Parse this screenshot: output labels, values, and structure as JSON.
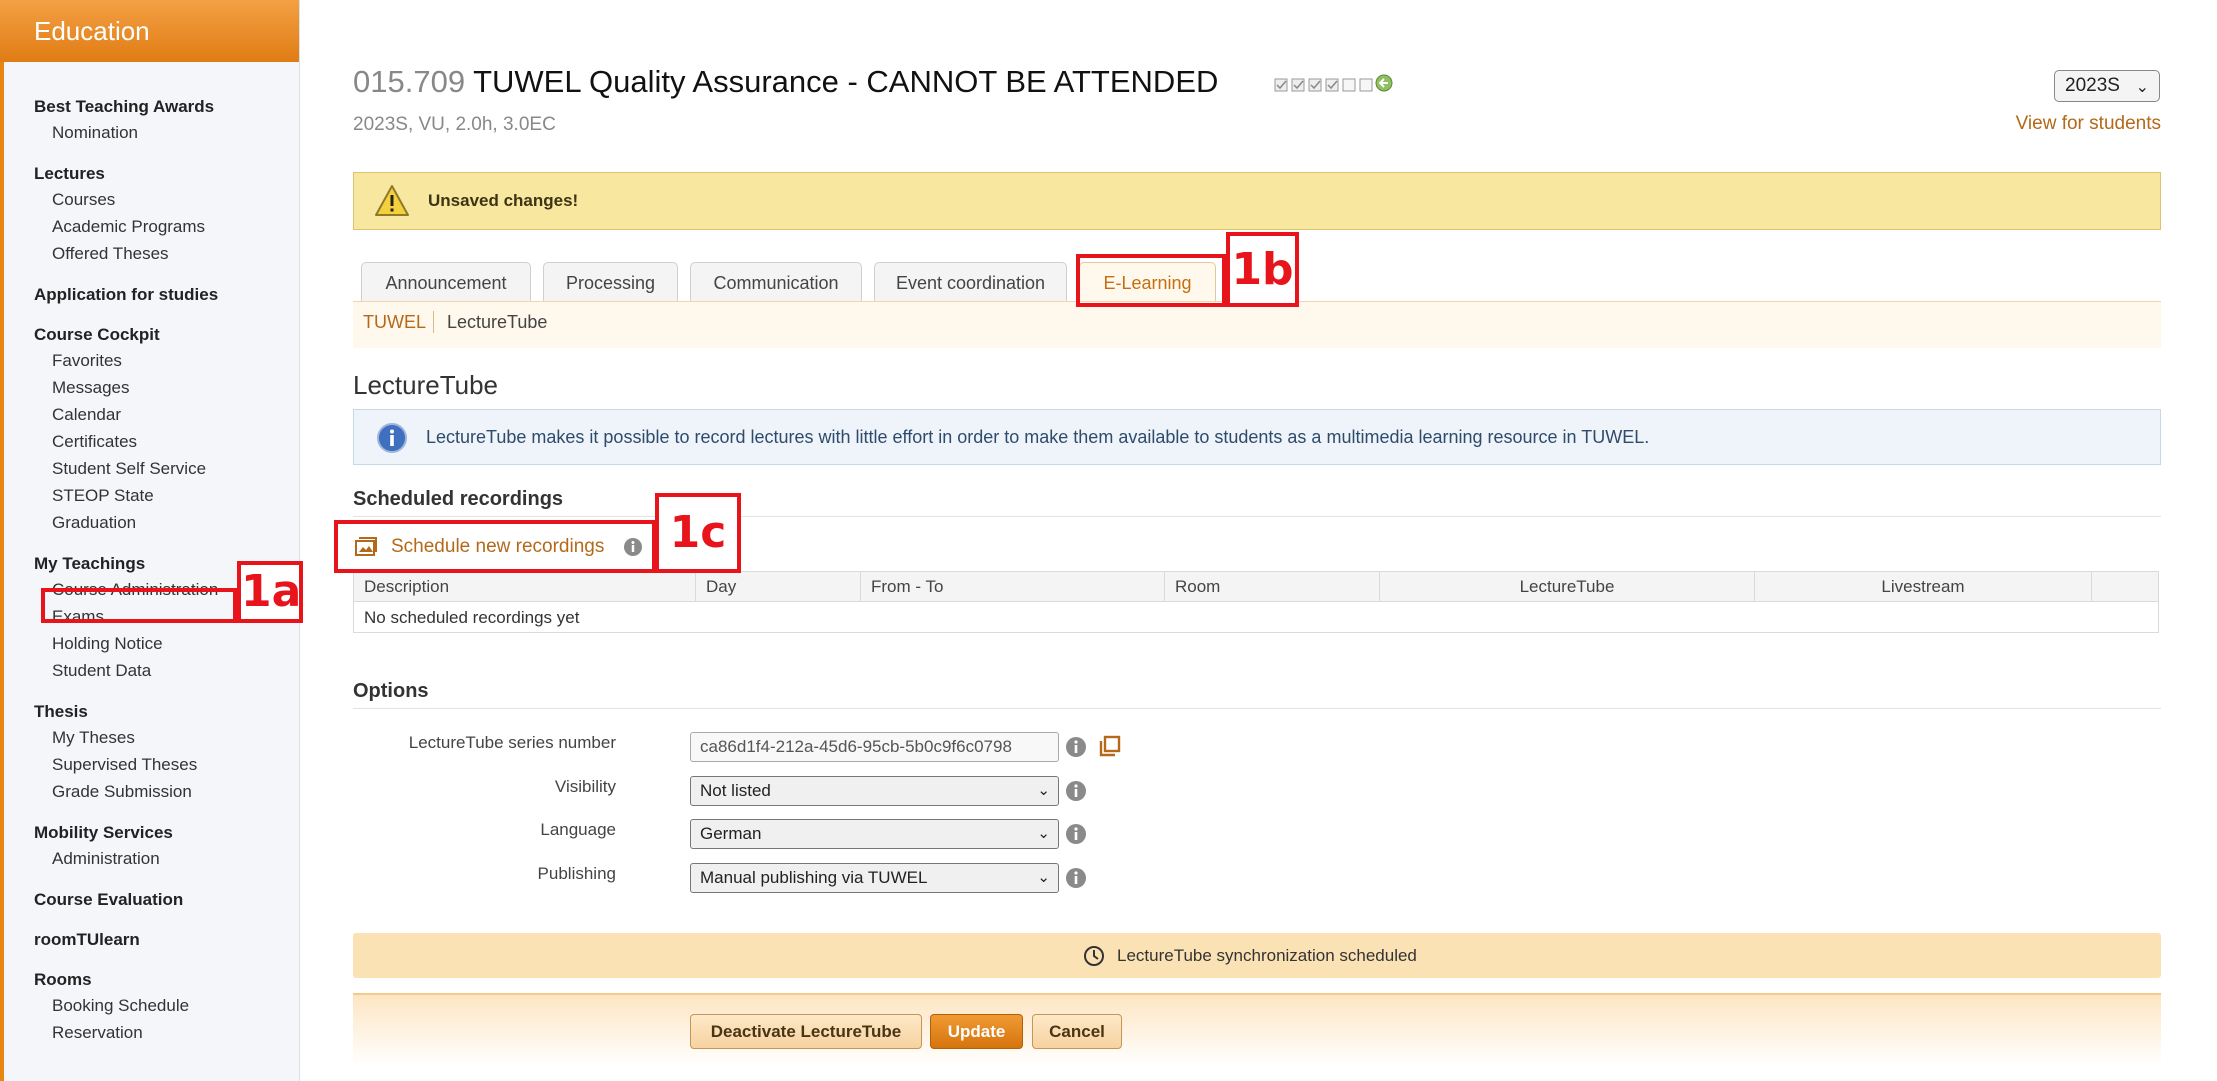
{
  "sidebar": {
    "brand": "Education",
    "groups": [
      {
        "heading": "Best Teaching Awards",
        "items": [
          "Nomination"
        ]
      },
      {
        "heading": "Lectures",
        "items": [
          "Courses",
          "Academic Programs",
          "Offered Theses"
        ]
      },
      {
        "heading": "Application for studies",
        "items": []
      },
      {
        "heading": "Course Cockpit",
        "items": [
          "Favorites",
          "Messages",
          "Calendar",
          "Certificates",
          "Student Self Service",
          "STEOP State",
          "Graduation"
        ]
      },
      {
        "heading": "My Teachings",
        "items": [
          "Course Administration",
          "Exams",
          "Holding Notice",
          "Student Data"
        ]
      },
      {
        "heading": "Thesis",
        "items": [
          "My Theses",
          "Supervised Theses",
          "Grade Submission"
        ]
      },
      {
        "heading": "Mobility Services",
        "items": [
          "Administration"
        ]
      },
      {
        "heading": "Course Evaluation",
        "items": []
      },
      {
        "heading": "roomTUlearn",
        "items": []
      },
      {
        "heading": "Rooms",
        "items": [
          "Booking Schedule",
          "Reservation"
        ]
      }
    ]
  },
  "header": {
    "course_number": "015.709",
    "course_title": "TUWEL Quality Assurance - CANNOT BE ATTENDED",
    "meta": "2023S, VU, 2.0h, 3.0EC",
    "semester": "2023S",
    "view_for_students": "View for students"
  },
  "banner": {
    "unsaved": "Unsaved changes!"
  },
  "tabs": [
    "Announcement",
    "Processing",
    "Communication",
    "Event coordination",
    "E-Learning"
  ],
  "active_tab": "E-Learning",
  "subnav": {
    "tuwel": "TUWEL",
    "lecturetube": "LectureTube"
  },
  "section": {
    "title": "LectureTube",
    "info": "LectureTube makes it possible to record lectures with little effort in order to make them available to students as a multimedia learning resource in TUWEL."
  },
  "scheduled": {
    "heading": "Scheduled recordings",
    "new_link": "Schedule new recordings",
    "columns": [
      "Description",
      "Day",
      "From - To",
      "Room",
      "LectureTube",
      "Livestream"
    ],
    "empty": "No scheduled recordings yet"
  },
  "options": {
    "heading": "Options",
    "series_label": "LectureTube series number",
    "series_value": "ca86d1f4-212a-45d6-95cb-5b0c9f6c0798",
    "visibility_label": "Visibility",
    "visibility_value": "Not listed",
    "language_label": "Language",
    "language_value": "German",
    "publishing_label": "Publishing",
    "publishing_value": "Manual publishing via TUWEL"
  },
  "sync": {
    "text": "LectureTube synchronization scheduled"
  },
  "buttons": {
    "deactivate": "Deactivate LectureTube",
    "update": "Update",
    "cancel": "Cancel"
  },
  "annotations": {
    "a": "1a",
    "b": "1b",
    "c": "1c"
  },
  "colors": {
    "accent": "#e07c14",
    "link": "#b4691a",
    "annotation": "#e8141c",
    "warning_bg": "#f8e79e",
    "info_bg": "#eef4fa"
  }
}
